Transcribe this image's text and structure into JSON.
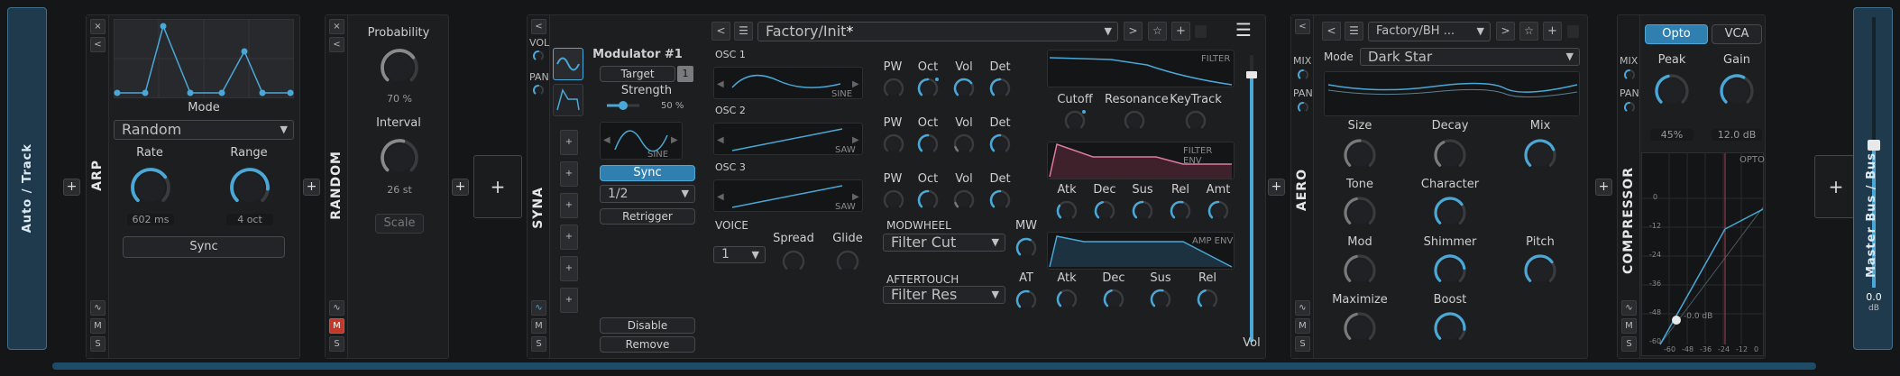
{
  "colors": {
    "accent": "#4aa8d8",
    "panel": "#1d1e20",
    "bg": "#151618",
    "mute_red": "#c0392b",
    "filter_env": "#e07aa0"
  },
  "auto_track": {
    "label": "Auto / Track"
  },
  "arp": {
    "title": "ARP",
    "mode_label": "Mode",
    "mode_value": "Random",
    "rate_label": "Rate",
    "rate_value": "602 ms",
    "rate_level": 0.7,
    "range_label": "Range",
    "range_value": "4 oct",
    "range_level": 0.85,
    "sync_label": "Sync"
  },
  "random": {
    "title": "RANDOM",
    "probability_label": "Probability",
    "probability_value": "70 %",
    "probability_level": 0.7,
    "interval_label": "Interval",
    "interval_value": "26 st",
    "interval_level": 0.55,
    "scale_label": "Scale"
  },
  "syna": {
    "title": "SYNA",
    "vol_label": "VOL",
    "pan_label": "PAN",
    "modulator": {
      "title": "Modulator #1",
      "target_label": "Target",
      "target_count": "1",
      "strength_label": "Strength",
      "strength_value": "50 %",
      "strength_level": 0.5,
      "wave_label": "SINE",
      "sync_label": "Sync",
      "rate_value": "1/2",
      "retrigger_label": "Retrigger",
      "disable_label": "Disable",
      "remove_label": "Remove"
    },
    "preset": {
      "name": "Factory/Init",
      "modified": "*"
    },
    "osc": [
      {
        "label": "OSC 1",
        "wave": "SINE"
      },
      {
        "label": "OSC 2",
        "wave": "SAW"
      },
      {
        "label": "OSC 3",
        "wave": "SAW"
      }
    ],
    "osc_params": [
      "PW",
      "Oct",
      "Vol",
      "Det"
    ],
    "voice_label": "VOICE",
    "voice_value": "1",
    "spread_label": "Spread",
    "glide_label": "Glide",
    "modwheel_label": "MODWHEEL",
    "modwheel_target": "Filter Cut",
    "mw_label": "MW",
    "aftertouch_label": "AFTERTOUCH",
    "aftertouch_target": "Filter Res",
    "at_label": "AT",
    "filter_label": "FILTER",
    "cutoff_label": "Cutoff",
    "resonance_label": "Resonance",
    "keytrack_label": "KeyTrack",
    "filter_env_label": "FILTER ENV",
    "env_params": [
      "Atk",
      "Dec",
      "Sus",
      "Rel",
      "Amt"
    ],
    "amp_env_label": "AMP ENV",
    "amp_params": [
      "Atk",
      "Dec",
      "Sus",
      "Rel"
    ],
    "vol_slider_label": "Vol"
  },
  "aero": {
    "title": "AERO",
    "mix_label": "MIX",
    "pan_label": "PAN",
    "preset_name": "Factory/BH ...",
    "mode_label": "Mode",
    "mode_value": "Dark Star",
    "knobs": [
      {
        "label": "Size",
        "level": 0.5
      },
      {
        "label": "Decay",
        "level": 0.4
      },
      {
        "label": "Mix",
        "level": 0.75
      },
      {
        "label": "Tone",
        "level": 0.45
      },
      {
        "label": "Character",
        "level": 0.7
      },
      {
        "label": "Mod",
        "level": 0.45
      },
      {
        "label": "Shimmer",
        "level": 0.8
      },
      {
        "label": "Pitch",
        "level": 0.7
      },
      {
        "label": "Maximize",
        "level": 0.45
      },
      {
        "label": "Boost",
        "level": 0.85
      }
    ]
  },
  "compressor": {
    "title": "COMPRESSOR",
    "mix_label": "MIX",
    "pan_label": "PAN",
    "opto_label": "Opto",
    "vca_label": "VCA",
    "peak_label": "Peak",
    "peak_value": "45%",
    "peak_level": 0.45,
    "gain_label": "Gain",
    "gain_value": "12.0 dB",
    "gain_level": 0.6,
    "graph_label": "OPTO",
    "threshold_label": "-0.0 dB",
    "y_ticks": [
      "0",
      "-12",
      "-24",
      "-36",
      "-48",
      "-60"
    ],
    "x_ticks": [
      "-60",
      "-48",
      "-36",
      "-24",
      "-12",
      "0"
    ]
  },
  "master": {
    "label": "Master Bus / Bus",
    "value": "0.0",
    "unit": "dB"
  },
  "common": {
    "plus": "+",
    "close": "×",
    "collapse": "<",
    "m": "M",
    "s": "S"
  }
}
